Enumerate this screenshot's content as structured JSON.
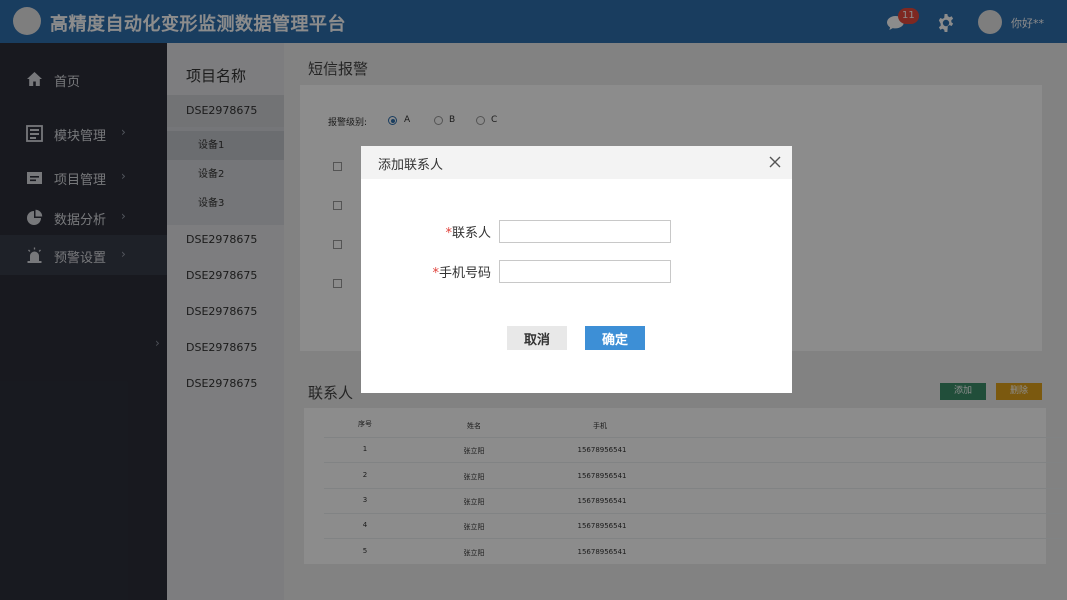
{
  "header": {
    "title": "高精度自动化变形监测数据管理平台",
    "notification_count": "11",
    "username": "你好**"
  },
  "sidebar": {
    "items": [
      {
        "label": "首页",
        "icon": "home-icon"
      },
      {
        "label": "模块管理",
        "icon": "module-icon"
      },
      {
        "label": "项目管理",
        "icon": "project-icon"
      },
      {
        "label": "数据分析",
        "icon": "pie-chart-icon"
      },
      {
        "label": "预警设置",
        "icon": "alarm-icon"
      }
    ],
    "chevron": "›"
  },
  "projects": {
    "heading": "项目名称",
    "items": [
      "DSE2978675",
      "DSE2978675",
      "DSE2978675",
      "DSE2978675",
      "DSE2978675",
      "DSE2978675"
    ],
    "devices": [
      "设备1",
      "设备2",
      "设备3"
    ]
  },
  "main": {
    "sms_title": "短信报警",
    "level_label": "报警级别:",
    "levels": [
      "A",
      "B",
      "C"
    ],
    "selected_level": "A",
    "contacts_title": "联系人",
    "add_label": "添加",
    "delete_label": "删除",
    "table": {
      "headers": [
        "序号",
        "姓名",
        "手机"
      ],
      "rows": [
        [
          "1",
          "张立阳",
          "15678956541"
        ],
        [
          "2",
          "张立阳",
          "15678956541"
        ],
        [
          "3",
          "张立阳",
          "15678956541"
        ],
        [
          "4",
          "张立阳",
          "15678956541"
        ],
        [
          "5",
          "张立阳",
          "15678956541"
        ]
      ]
    }
  },
  "dialog": {
    "title": "添加联系人",
    "required_mark": "*",
    "contact_label": "联系人",
    "contact_value": "",
    "phone_label": "手机号码",
    "phone_value": "",
    "cancel_label": "取消",
    "ok_label": "确定"
  },
  "colors": {
    "topbar": "#2f6fae",
    "sidebar": "#2c2f3a",
    "add_button": "#3c8f6a",
    "delete_button": "#e0a21c",
    "ok_button": "#3d8fd6",
    "badge": "#e64a3c"
  }
}
